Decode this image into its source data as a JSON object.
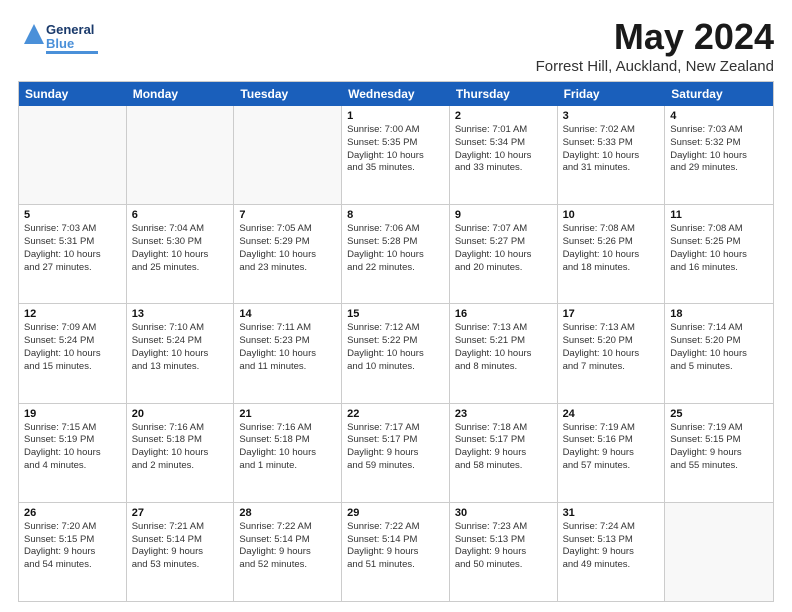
{
  "header": {
    "logo_general": "General",
    "logo_blue": "Blue",
    "title": "May 2024",
    "subtitle": "Forrest Hill, Auckland, New Zealand"
  },
  "days_of_week": [
    "Sunday",
    "Monday",
    "Tuesday",
    "Wednesday",
    "Thursday",
    "Friday",
    "Saturday"
  ],
  "weeks": [
    [
      {
        "day": "",
        "info": ""
      },
      {
        "day": "",
        "info": ""
      },
      {
        "day": "",
        "info": ""
      },
      {
        "day": "1",
        "info": "Sunrise: 7:00 AM\nSunset: 5:35 PM\nDaylight: 10 hours\nand 35 minutes."
      },
      {
        "day": "2",
        "info": "Sunrise: 7:01 AM\nSunset: 5:34 PM\nDaylight: 10 hours\nand 33 minutes."
      },
      {
        "day": "3",
        "info": "Sunrise: 7:02 AM\nSunset: 5:33 PM\nDaylight: 10 hours\nand 31 minutes."
      },
      {
        "day": "4",
        "info": "Sunrise: 7:03 AM\nSunset: 5:32 PM\nDaylight: 10 hours\nand 29 minutes."
      }
    ],
    [
      {
        "day": "5",
        "info": "Sunrise: 7:03 AM\nSunset: 5:31 PM\nDaylight: 10 hours\nand 27 minutes."
      },
      {
        "day": "6",
        "info": "Sunrise: 7:04 AM\nSunset: 5:30 PM\nDaylight: 10 hours\nand 25 minutes."
      },
      {
        "day": "7",
        "info": "Sunrise: 7:05 AM\nSunset: 5:29 PM\nDaylight: 10 hours\nand 23 minutes."
      },
      {
        "day": "8",
        "info": "Sunrise: 7:06 AM\nSunset: 5:28 PM\nDaylight: 10 hours\nand 22 minutes."
      },
      {
        "day": "9",
        "info": "Sunrise: 7:07 AM\nSunset: 5:27 PM\nDaylight: 10 hours\nand 20 minutes."
      },
      {
        "day": "10",
        "info": "Sunrise: 7:08 AM\nSunset: 5:26 PM\nDaylight: 10 hours\nand 18 minutes."
      },
      {
        "day": "11",
        "info": "Sunrise: 7:08 AM\nSunset: 5:25 PM\nDaylight: 10 hours\nand 16 minutes."
      }
    ],
    [
      {
        "day": "12",
        "info": "Sunrise: 7:09 AM\nSunset: 5:24 PM\nDaylight: 10 hours\nand 15 minutes."
      },
      {
        "day": "13",
        "info": "Sunrise: 7:10 AM\nSunset: 5:24 PM\nDaylight: 10 hours\nand 13 minutes."
      },
      {
        "day": "14",
        "info": "Sunrise: 7:11 AM\nSunset: 5:23 PM\nDaylight: 10 hours\nand 11 minutes."
      },
      {
        "day": "15",
        "info": "Sunrise: 7:12 AM\nSunset: 5:22 PM\nDaylight: 10 hours\nand 10 minutes."
      },
      {
        "day": "16",
        "info": "Sunrise: 7:13 AM\nSunset: 5:21 PM\nDaylight: 10 hours\nand 8 minutes."
      },
      {
        "day": "17",
        "info": "Sunrise: 7:13 AM\nSunset: 5:20 PM\nDaylight: 10 hours\nand 7 minutes."
      },
      {
        "day": "18",
        "info": "Sunrise: 7:14 AM\nSunset: 5:20 PM\nDaylight: 10 hours\nand 5 minutes."
      }
    ],
    [
      {
        "day": "19",
        "info": "Sunrise: 7:15 AM\nSunset: 5:19 PM\nDaylight: 10 hours\nand 4 minutes."
      },
      {
        "day": "20",
        "info": "Sunrise: 7:16 AM\nSunset: 5:18 PM\nDaylight: 10 hours\nand 2 minutes."
      },
      {
        "day": "21",
        "info": "Sunrise: 7:16 AM\nSunset: 5:18 PM\nDaylight: 10 hours\nand 1 minute."
      },
      {
        "day": "22",
        "info": "Sunrise: 7:17 AM\nSunset: 5:17 PM\nDaylight: 9 hours\nand 59 minutes."
      },
      {
        "day": "23",
        "info": "Sunrise: 7:18 AM\nSunset: 5:17 PM\nDaylight: 9 hours\nand 58 minutes."
      },
      {
        "day": "24",
        "info": "Sunrise: 7:19 AM\nSunset: 5:16 PM\nDaylight: 9 hours\nand 57 minutes."
      },
      {
        "day": "25",
        "info": "Sunrise: 7:19 AM\nSunset: 5:15 PM\nDaylight: 9 hours\nand 55 minutes."
      }
    ],
    [
      {
        "day": "26",
        "info": "Sunrise: 7:20 AM\nSunset: 5:15 PM\nDaylight: 9 hours\nand 54 minutes."
      },
      {
        "day": "27",
        "info": "Sunrise: 7:21 AM\nSunset: 5:14 PM\nDaylight: 9 hours\nand 53 minutes."
      },
      {
        "day": "28",
        "info": "Sunrise: 7:22 AM\nSunset: 5:14 PM\nDaylight: 9 hours\nand 52 minutes."
      },
      {
        "day": "29",
        "info": "Sunrise: 7:22 AM\nSunset: 5:14 PM\nDaylight: 9 hours\nand 51 minutes."
      },
      {
        "day": "30",
        "info": "Sunrise: 7:23 AM\nSunset: 5:13 PM\nDaylight: 9 hours\nand 50 minutes."
      },
      {
        "day": "31",
        "info": "Sunrise: 7:24 AM\nSunset: 5:13 PM\nDaylight: 9 hours\nand 49 minutes."
      },
      {
        "day": "",
        "info": ""
      }
    ]
  ]
}
